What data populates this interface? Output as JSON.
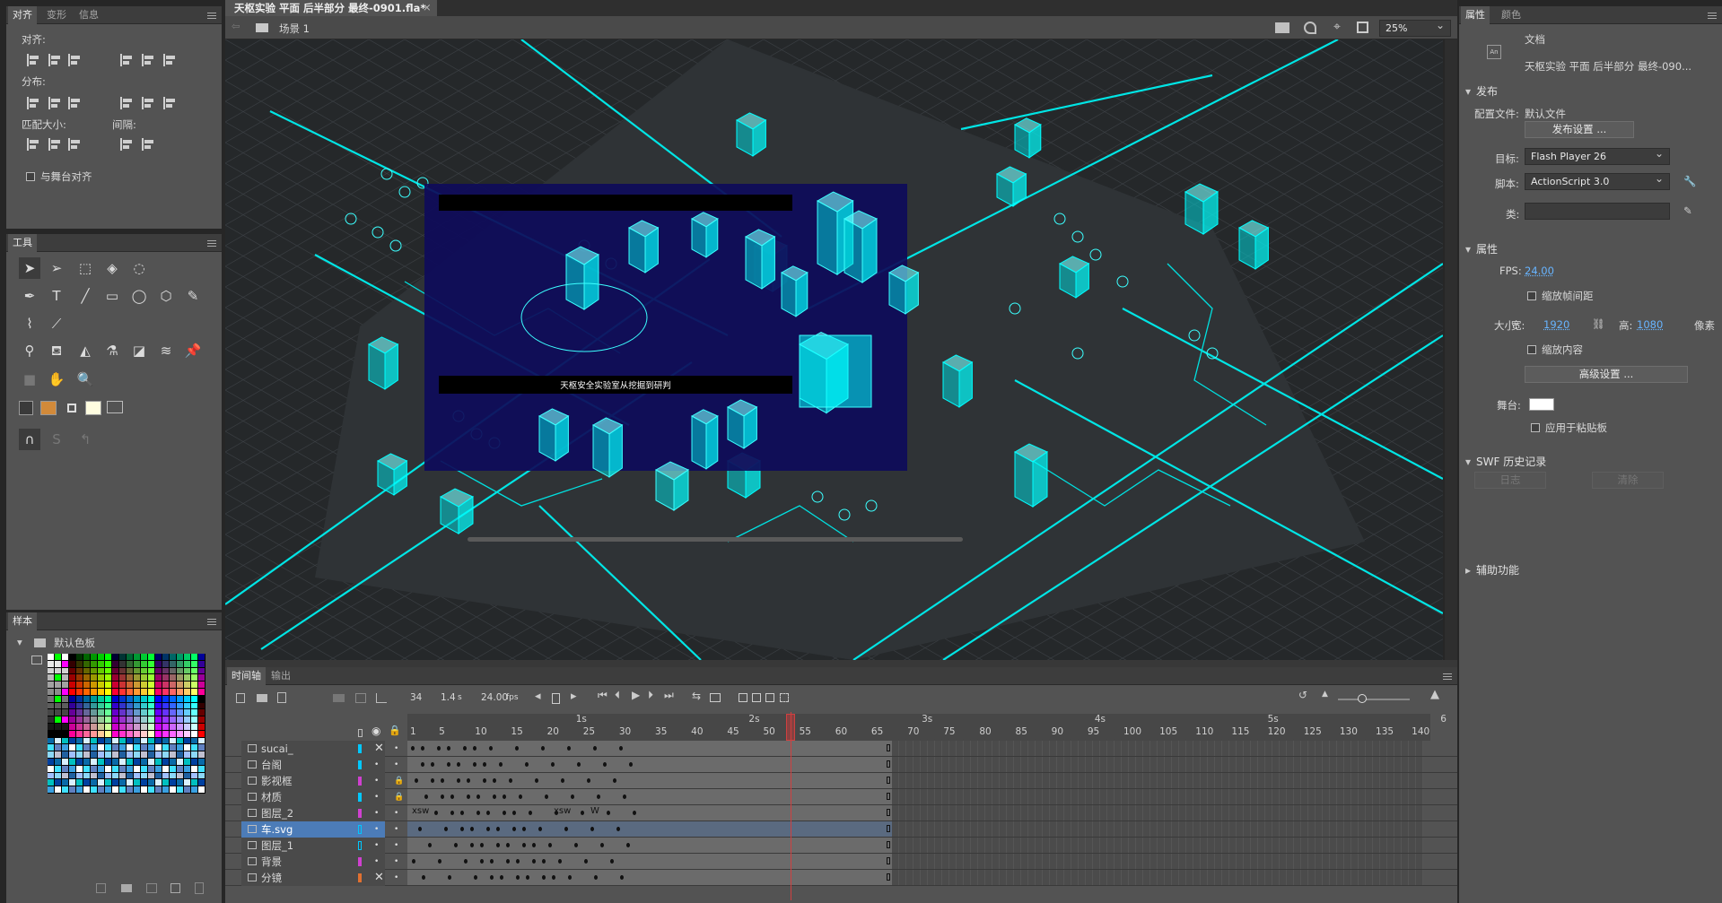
{
  "left_panels": {
    "align_tabs": [
      "对齐",
      "变形",
      "信息"
    ],
    "align_label": "对齐:",
    "distribute_label": "分布:",
    "match_size_label": "匹配大小:",
    "spacing_label": "间隔:",
    "align_to_stage": "与舞台对齐",
    "tools_title": "工具",
    "swatches_title": "样本",
    "swatches_folder": "默认色板"
  },
  "document_tab": {
    "title": "天枢实验 平面 后半部分 最终-0901.fla*",
    "scene": "场景 1",
    "zoom": "25%"
  },
  "stage": {
    "caption": "天枢安全实验室从挖掘到研判"
  },
  "timeline": {
    "tabs": [
      "时间轴",
      "输出"
    ],
    "current_frame": "34",
    "time": "1.4",
    "time_unit": "s",
    "fps": "24.00",
    "fps_unit": "fps",
    "ruler_numbers": [
      "1",
      "5",
      "10",
      "15",
      "20",
      "25",
      "30",
      "35",
      "40",
      "45",
      "50",
      "55",
      "60",
      "65",
      "70",
      "75",
      "80",
      "85",
      "90",
      "95",
      "100",
      "105",
      "110",
      "115",
      "120",
      "125",
      "130",
      "135",
      "140"
    ],
    "ruler_seconds": [
      "1s",
      "2s",
      "3s",
      "4s",
      "5s",
      "6"
    ],
    "layers": [
      {
        "name": "sucai_",
        "color": "#00c8ff",
        "hidden": true,
        "locked": false
      },
      {
        "name": "台阁",
        "color": "#00c8ff",
        "hidden": false,
        "locked": false
      },
      {
        "name": "影视框",
        "color": "#d040d0",
        "hidden": false,
        "locked": true
      },
      {
        "name": "材质",
        "color": "#00c8ff",
        "hidden": false,
        "locked": true
      },
      {
        "name": "图层_2",
        "color": "#d040d0",
        "hidden": false,
        "locked": false
      },
      {
        "name": "车.svg",
        "color": "#00c8ff",
        "hidden": false,
        "locked": false
      },
      {
        "name": "图层_1",
        "color": "#00c8ff",
        "hidden": false,
        "locked": false
      },
      {
        "name": "背景",
        "color": "#d040d0",
        "hidden": false,
        "locked": false
      },
      {
        "name": "分镜",
        "color": "#e07030",
        "hidden": true,
        "locked": false
      }
    ],
    "labels_row5": [
      "xsw",
      "xsw",
      "W"
    ]
  },
  "properties": {
    "tabs": [
      "属性",
      "颜色"
    ],
    "doc_type": "文档",
    "doc_name": "天枢实验 平面 后半部分 最终-090...",
    "publish_section": "发布",
    "profile_label": "配置文件:",
    "profile_value": "默认文件",
    "publish_settings_button": "发布设置 ...",
    "target_label": "目标:",
    "target_value": "Flash Player 26",
    "script_label": "脚本:",
    "script_value": "ActionScript 3.0",
    "class_label": "类:",
    "props_section": "属性",
    "fps_label": "FPS:",
    "fps_value": "24.00",
    "scale_spans": "缩放帧间距",
    "size_label": "大小:",
    "width_label": "宽:",
    "width_value": "1920",
    "height_label": "高:",
    "height_value": "1080",
    "unit": "像素",
    "scale_content": "缩放内容",
    "advanced_button": "高级设置 ...",
    "stage_label": "舞台:",
    "apply_pasteboard": "应用于粘贴板",
    "swf_section": "SWF 历史记录",
    "log_button": "日志",
    "clear_button": "清除",
    "accessibility_section": "辅助功能"
  }
}
